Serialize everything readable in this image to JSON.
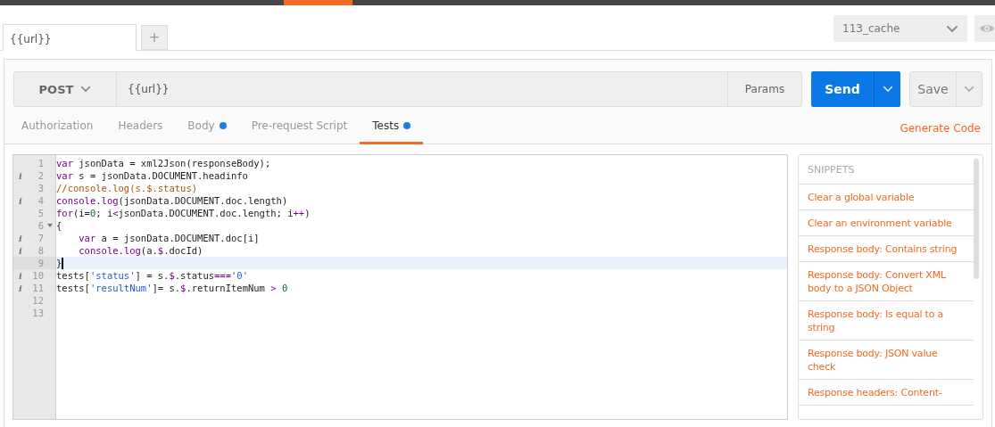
{
  "request_tabs": [
    {
      "label": "{{url}}",
      "selected": true
    }
  ],
  "new_tab": "+",
  "environment": {
    "value": "113_cache"
  },
  "request": {
    "method": "POST",
    "url": "{{url}}",
    "params": "Params",
    "send": "Send",
    "save": "Save"
  },
  "section_tabs": [
    {
      "label": "Authorization",
      "selected": false,
      "dot": false
    },
    {
      "label": "Headers",
      "selected": false,
      "dot": false
    },
    {
      "label": "Body",
      "selected": false,
      "dot": true
    },
    {
      "label": "Pre-request Script",
      "selected": false,
      "dot": false
    },
    {
      "label": "Tests",
      "selected": true,
      "dot": true
    }
  ],
  "generate_code": "Generate Code",
  "editor": {
    "lines": [
      {
        "number": "1",
        "tokens": [
          {
            "kind": "keyword",
            "text": "var"
          },
          {
            "kind": "plain",
            "text": " jsonData = xml2Json(responseBody);"
          }
        ]
      },
      {
        "number": "2",
        "marker": "i",
        "tokens": [
          {
            "kind": "keyword",
            "text": "var"
          },
          {
            "kind": "plain",
            "text": " s = jsonData.DOCUMENT.headinfo"
          }
        ]
      },
      {
        "number": "3",
        "tokens": [
          {
            "kind": "comment",
            "text": "//console.log(s.$.status)"
          }
        ]
      },
      {
        "number": "4",
        "marker": "i",
        "tokens": [
          {
            "kind": "keyword",
            "text": "console"
          },
          {
            "kind": "plain",
            "text": "."
          },
          {
            "kind": "keyword",
            "text": "log"
          },
          {
            "kind": "plain",
            "text": "(jsonData.DOCUMENT.doc.length)"
          }
        ]
      },
      {
        "number": "5",
        "tokens": [
          {
            "kind": "keyword",
            "text": "for"
          },
          {
            "kind": "plain",
            "text": "(i="
          },
          {
            "kind": "number",
            "text": "0"
          },
          {
            "kind": "plain",
            "text": "; i"
          },
          {
            "kind": "keyword",
            "text": "<"
          },
          {
            "kind": "plain",
            "text": "jsonData.DOCUMENT.doc.length; i"
          },
          {
            "kind": "keyword",
            "text": "++"
          },
          {
            "kind": "plain",
            "text": ")"
          }
        ]
      },
      {
        "number": "6",
        "fold": true,
        "tokens": [
          {
            "kind": "plain",
            "text": "{"
          }
        ]
      },
      {
        "number": "7",
        "marker": "i",
        "tokens": [
          {
            "kind": "keyword",
            "text": "    var"
          },
          {
            "kind": "plain",
            "text": " a = jsonData.DOCUMENT.doc[i]"
          }
        ]
      },
      {
        "number": "8",
        "marker": "i",
        "tokens": [
          {
            "kind": "keyword",
            "text": "    console"
          },
          {
            "kind": "plain",
            "text": "."
          },
          {
            "kind": "keyword",
            "text": "log"
          },
          {
            "kind": "plain",
            "text": "(a."
          },
          {
            "kind": "keyword",
            "text": "$"
          },
          {
            "kind": "plain",
            "text": ".docId)"
          }
        ]
      },
      {
        "number": "9",
        "active": true,
        "tokens": [
          {
            "kind": "plain",
            "text": "}"
          }
        ]
      },
      {
        "number": "10",
        "marker": "i",
        "tokens": [
          {
            "kind": "plain",
            "text": "tests["
          },
          {
            "kind": "string",
            "text": "'status'"
          },
          {
            "kind": "plain",
            "text": "] = s."
          },
          {
            "kind": "keyword",
            "text": "$"
          },
          {
            "kind": "plain",
            "text": ".status"
          },
          {
            "kind": "keyword",
            "text": "==="
          },
          {
            "kind": "string",
            "text": "'0'"
          }
        ]
      },
      {
        "number": "11",
        "marker": "i",
        "tokens": [
          {
            "kind": "plain",
            "text": "tests["
          },
          {
            "kind": "string",
            "text": "'resultNum'"
          },
          {
            "kind": "plain",
            "text": "]= s."
          },
          {
            "kind": "keyword",
            "text": "$"
          },
          {
            "kind": "plain",
            "text": ".returnItemNum "
          },
          {
            "kind": "keyword",
            "text": "> "
          },
          {
            "kind": "number",
            "text": "0"
          }
        ]
      },
      {
        "number": "12"
      },
      {
        "number": "13"
      }
    ]
  },
  "snippets": {
    "title": "SNIPPETS",
    "items": [
      "Clear a global variable",
      "Clear an environment variable",
      "Response body: Contains string",
      "Response body: Convert XML body to a JSON Object",
      "Response body: Is equal to a string",
      "Response body: JSON value check",
      "Response headers: Content-"
    ]
  }
}
